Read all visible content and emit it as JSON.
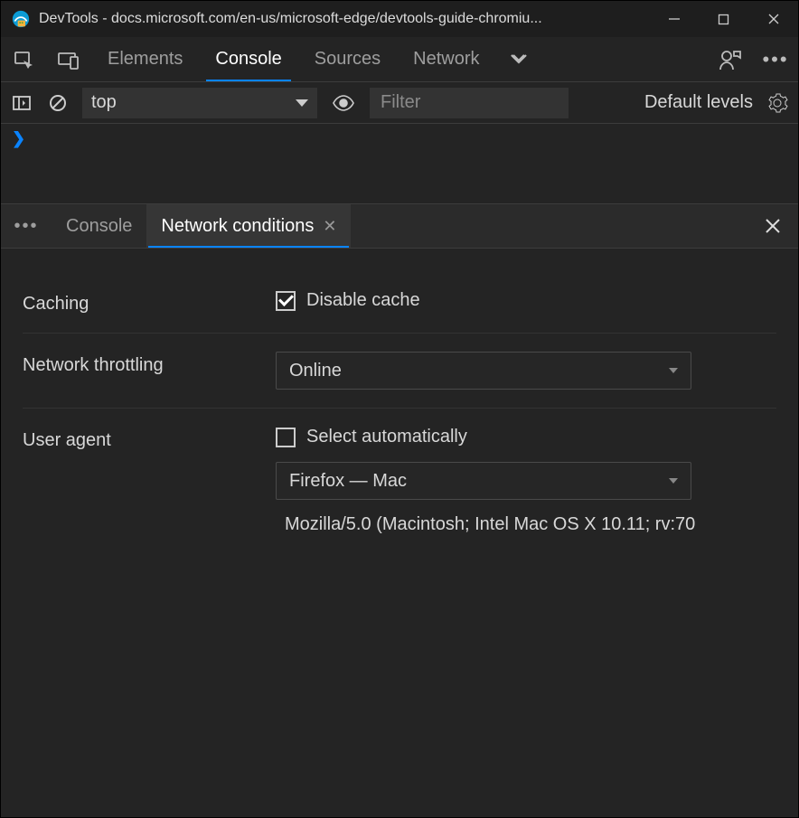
{
  "window": {
    "title": "DevTools - docs.microsoft.com/en-us/microsoft-edge/devtools-guide-chromiu..."
  },
  "main_tabs": {
    "elements": "Elements",
    "console": "Console",
    "sources": "Sources",
    "network": "Network"
  },
  "toolbar": {
    "context": "top",
    "filter_placeholder": "Filter",
    "levels": "Default levels"
  },
  "console": {
    "prompt": "❯"
  },
  "drawer_tabs": {
    "console": "Console",
    "network_conditions": "Network conditions"
  },
  "network_conditions": {
    "caching_label": "Caching",
    "disable_cache_label": "Disable cache",
    "disable_cache_checked": true,
    "throttling_label": "Network throttling",
    "throttling_value": "Online",
    "ua_label": "User agent",
    "ua_auto_label": "Select automatically",
    "ua_auto_checked": false,
    "ua_value": "Firefox — Mac",
    "ua_string": "Mozilla/5.0 (Macintosh; Intel Mac OS X 10.11; rv:70"
  }
}
